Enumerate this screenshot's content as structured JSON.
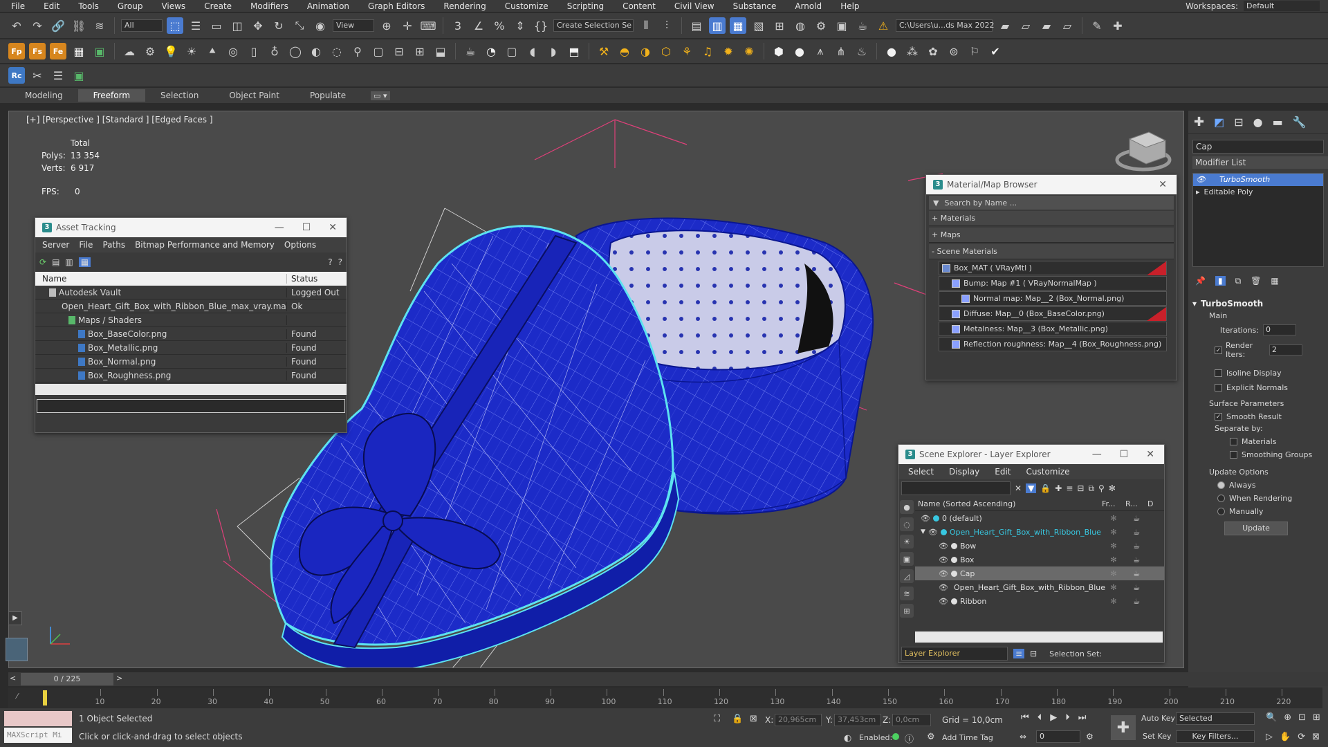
{
  "menu": {
    "items": [
      "File",
      "Edit",
      "Tools",
      "Group",
      "Views",
      "Create",
      "Modifiers",
      "Animation",
      "Graph Editors",
      "Rendering",
      "Customize",
      "Scripting",
      "Content",
      "Civil View",
      "Substance",
      "Arnold",
      "Help"
    ],
    "workspace_label": "Workspaces:",
    "workspace_value": "Default"
  },
  "toolbar": {
    "filter_value": "All",
    "view_value": "View",
    "selection_set_placeholder": "Create Selection Se",
    "project_path": "C:\\Users\\u...ds Max 2022"
  },
  "ribbon": {
    "tabs": [
      "Modeling",
      "Freeform",
      "Selection",
      "Object Paint",
      "Populate"
    ],
    "active": "Freeform"
  },
  "viewport": {
    "label": "[+] [Perspective ] [Standard ] [Edged Faces ]",
    "stats": {
      "total_label": "Total",
      "polys_label": "Polys:",
      "polys_value": "13 354",
      "verts_label": "Verts:",
      "verts_value": "6 917",
      "fps_label": "FPS:",
      "fps_value": "0"
    }
  },
  "asset_tracking": {
    "title": "Asset Tracking",
    "menu": [
      "Server",
      "File",
      "Paths",
      "Bitmap Performance and Memory",
      "Options"
    ],
    "col_name": "Name",
    "col_status": "Status",
    "rows": [
      {
        "name": "Autodesk Vault",
        "status": "Logged Out ...",
        "indent": 0
      },
      {
        "name": "Open_Heart_Gift_Box_with_Ribbon_Blue_max_vray.max",
        "status": "Ok",
        "indent": 1
      },
      {
        "name": "Maps / Shaders",
        "status": "",
        "indent": 2
      },
      {
        "name": "Box_BaseColor.png",
        "status": "Found",
        "indent": 3
      },
      {
        "name": "Box_Metallic.png",
        "status": "Found",
        "indent": 3
      },
      {
        "name": "Box_Normal.png",
        "status": "Found",
        "indent": 3
      },
      {
        "name": "Box_Roughness.png",
        "status": "Found",
        "indent": 3
      }
    ]
  },
  "material_browser": {
    "title": "Material/Map Browser",
    "search_placeholder": "Search by Name ...",
    "sections": [
      "+ Materials",
      "+ Maps",
      "- Scene Materials"
    ],
    "items": [
      {
        "label": "Box_MAT  ( VRayMtl )",
        "indent": 0,
        "red": true
      },
      {
        "label": "Bump: Map #1  ( VRayNormalMap )",
        "indent": 1,
        "red": false
      },
      {
        "label": "Normal map: Map__2 (Box_Normal.png)",
        "indent": 2,
        "red": false
      },
      {
        "label": "Diffuse: Map__0 (Box_BaseColor.png)",
        "indent": 1,
        "red": true
      },
      {
        "label": "Metalness: Map__3 (Box_Metallic.png)",
        "indent": 1,
        "red": false
      },
      {
        "label": "Reflection roughness: Map__4 (Box_Roughness.png)",
        "indent": 1,
        "red": false
      }
    ]
  },
  "scene_explorer": {
    "title": "Scene Explorer - Layer Explorer",
    "menu": [
      "Select",
      "Display",
      "Edit",
      "Customize"
    ],
    "col_name": "Name (Sorted Ascending)",
    "col_fr": "Fr...",
    "col_r": "R...",
    "col_d": "D",
    "rows": [
      {
        "name": "0 (default)",
        "indent": 0,
        "selected": false
      },
      {
        "name": "Open_Heart_Gift_Box_with_Ribbon_Blue",
        "indent": 0,
        "selected": false,
        "highlight": true
      },
      {
        "name": "Bow",
        "indent": 1,
        "selected": false
      },
      {
        "name": "Box",
        "indent": 1,
        "selected": false
      },
      {
        "name": "Cap",
        "indent": 1,
        "selected": true
      },
      {
        "name": "Open_Heart_Gift_Box_with_Ribbon_Blue",
        "indent": 1,
        "selected": false
      },
      {
        "name": "Ribbon",
        "indent": 1,
        "selected": false
      }
    ],
    "footer_explorer": "Layer Explorer",
    "footer_selection_set": "Selection Set:"
  },
  "command_panel": {
    "object_name": "Cap",
    "modifier_list": "Modifier List",
    "stack": [
      "TurboSmooth",
      "Editable Poly"
    ],
    "rollout_title": "TurboSmooth",
    "main_label": "Main",
    "iterations_label": "Iterations:",
    "iterations_value": "0",
    "render_iters_label": "Render Iters:",
    "render_iters_value": "2",
    "isoline_label": "Isoline Display",
    "explicit_normals_label": "Explicit Normals",
    "surface_params_label": "Surface Parameters",
    "smooth_result_label": "Smooth Result",
    "separate_by_label": "Separate by:",
    "materials_label": "Materials",
    "smoothing_groups_label": "Smoothing Groups",
    "update_options_label": "Update Options",
    "always_label": "Always",
    "when_rendering_label": "When Rendering",
    "manually_label": "Manually",
    "update_button": "Update"
  },
  "timeline": {
    "frame_counter": "0 / 225",
    "ticks": [
      "10",
      "20",
      "30",
      "40",
      "50",
      "60",
      "70",
      "80",
      "90",
      "100",
      "110",
      "120",
      "130",
      "140",
      "150",
      "160",
      "170",
      "180",
      "190",
      "200",
      "210",
      "220"
    ]
  },
  "status": {
    "maxscript": "MAXScript Mi",
    "selected": "1 Object Selected",
    "prompt": "Click or click-and-drag to select objects",
    "x_label": "X:",
    "x_value": "20,965cm",
    "y_label": "Y:",
    "y_value": "37,453cm",
    "z_label": "Z:",
    "z_value": "0,0cm",
    "grid": "Grid = 10,0cm",
    "enabled_label": "Enabled:",
    "add_time_tag": "Add Time Tag",
    "auto_key": "Auto Key",
    "key_mode": "Selected",
    "set_key": "Set Key",
    "key_filters": "Key Filters...",
    "frame_value": "0"
  },
  "colors": {
    "accent": "#4a7bd0",
    "box_blue": "#1c2bc8",
    "selection_cyan": "#5de2f0",
    "title_bar": "#f4f4f4",
    "highlight_cyan": "#38c7e0"
  }
}
